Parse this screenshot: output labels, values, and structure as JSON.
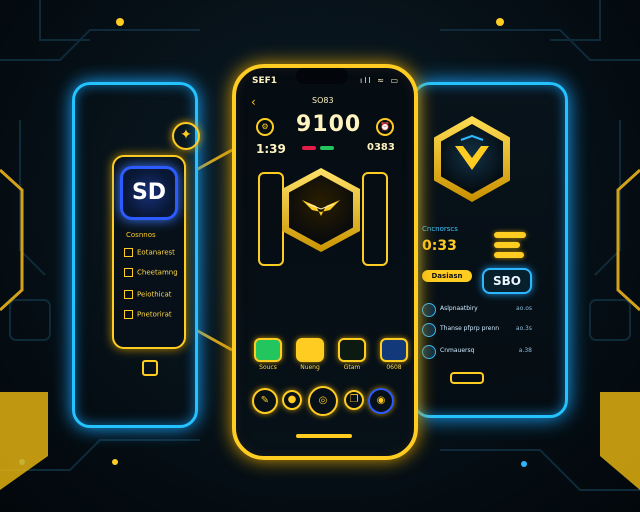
{
  "colors": {
    "accent": "#ffcc22",
    "glow_blue": "#24c3ff",
    "background": "#061017",
    "green": "#22c55e",
    "red": "#e11d48"
  },
  "left_panel": {
    "badge_text": "SD",
    "heading": "Cosnnos",
    "items": [
      "Eotanarest",
      "Cheetamng",
      "Peiothicat",
      "Pnetorirat"
    ],
    "icons": [
      "shield-wing-icon",
      "chip-icon"
    ]
  },
  "phone": {
    "status_time": "SEF1",
    "status_right": "ıll ≈ ▭",
    "nav_back": "‹",
    "nav_title": "SO83",
    "clock": "9100",
    "time_left": "1:39",
    "time_right": "0383",
    "apps": [
      {
        "name": "phone-app",
        "label": "Soucs"
      },
      {
        "name": "messages-app",
        "label": "Nueng"
      },
      {
        "name": "chat-app",
        "label": "Gtam"
      },
      {
        "name": "browser-app",
        "label": "0608"
      }
    ],
    "dock": [
      {
        "name": "pen-icon",
        "glyph": "✎"
      },
      {
        "name": "circle-icon",
        "glyph": "●"
      },
      {
        "name": "home-icon",
        "glyph": "◎"
      },
      {
        "name": "copy-icon",
        "glyph": "❐"
      },
      {
        "name": "globe-icon",
        "glyph": "◉"
      }
    ]
  },
  "right_panel": {
    "title": "Cncnorscs",
    "time": "0:33",
    "action_label": "Dasiasn",
    "count": "SBO",
    "list": [
      {
        "text": "Aslpnaatbiry",
        "value": "ao.os"
      },
      {
        "text": "Thanse pfprp prenn",
        "value": "ao.3s"
      },
      {
        "text": "Cnmauersq",
        "value": "a.38"
      }
    ]
  }
}
